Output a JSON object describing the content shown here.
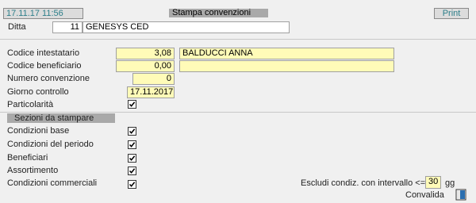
{
  "header": {
    "datetime": "17.11.17 11:56",
    "title": "Stampa convenzioni",
    "print_label": "Print"
  },
  "ditta": {
    "label": "Ditta",
    "code": "11",
    "name": "GENESYS CED"
  },
  "form": {
    "codice_intestatario": {
      "label": "Codice intestatario",
      "value": "3,08",
      "name": "BALDUCCI ANNA"
    },
    "codice_beneficiario": {
      "label": "Codice beneficiario",
      "value": "0,00",
      "name": ""
    },
    "numero_convenzione": {
      "label": "Numero convenzione",
      "value": "0"
    },
    "giorno_controllo": {
      "label": "Giorno controllo",
      "value": "17.11.2017"
    },
    "particolarita": {
      "label": "Particolarità",
      "checked": true
    }
  },
  "sezioni": {
    "header": "Sezioni da stampare",
    "items": [
      {
        "label": "Condizioni base",
        "checked": true
      },
      {
        "label": "Condizioni del periodo",
        "checked": true
      },
      {
        "label": "Beneficiari",
        "checked": true
      },
      {
        "label": "Assortimento",
        "checked": true
      },
      {
        "label": "Condizioni commerciali",
        "checked": true
      }
    ]
  },
  "escludi": {
    "label": "Escludi condiz. con intervallo <= a",
    "value": "30",
    "unit": "gg"
  },
  "footer": {
    "convalida_label": "Convalida",
    "icon": "door-icon"
  },
  "colors": {
    "field_yellow": "#fffbb8",
    "header_bar": "#a9a9a9",
    "accent_teal": "#2e7f8a"
  }
}
